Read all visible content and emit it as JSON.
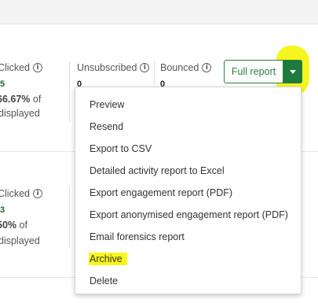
{
  "row1": {
    "clicked_label": "Clicked",
    "clicked_value": "5",
    "clicked_pct": "66.67%",
    "clicked_of": " of",
    "clicked_displayed": "displayed",
    "unsubscribed_label": "Unsubscribed",
    "unsubscribed_value": "0",
    "bounced_label": "Bounced",
    "bounced_value": "0",
    "full_report_label": "Full report"
  },
  "row2": {
    "clicked_label": "Clicked",
    "clicked_value": "3",
    "clicked_pct": "50%",
    "clicked_of": " of",
    "clicked_displayed": "displayed"
  },
  "menu": {
    "items": [
      "Preview",
      "Resend",
      "Export to CSV",
      "Detailed activity report to Excel",
      "Export engagement report (PDF)",
      "Export anonymised engagement report (PDF)",
      "Email forensics report",
      "Archive",
      "Delete"
    ]
  },
  "colors": {
    "accent_green": "#1f7a3d",
    "highlight_yellow": "#f4f512"
  }
}
